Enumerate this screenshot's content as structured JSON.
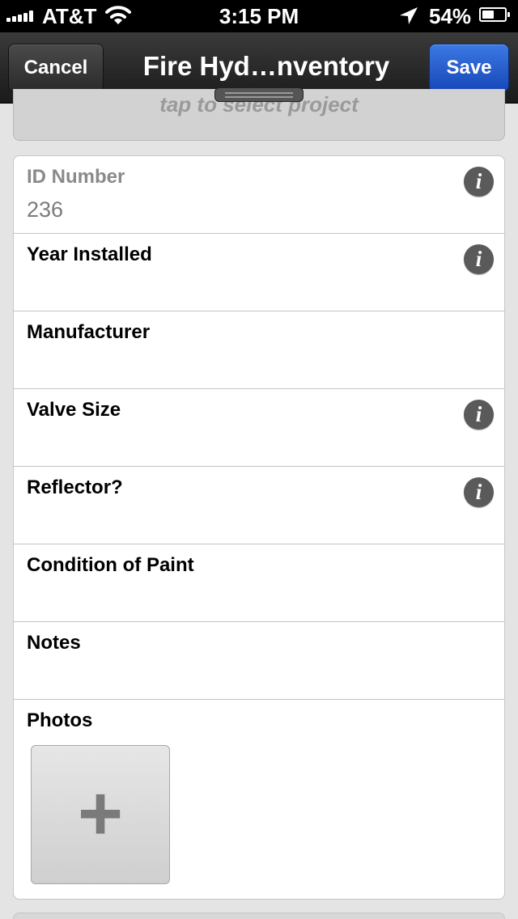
{
  "status_bar": {
    "carrier": "AT&T",
    "time": "3:15 PM",
    "battery_percent": "54%",
    "battery_level": 0.54,
    "icons": [
      "signal-icon",
      "wifi-icon",
      "location-arrow-icon",
      "battery-icon"
    ]
  },
  "nav": {
    "cancel_label": "Cancel",
    "title": "Fire Hyd…nventory",
    "save_label": "Save",
    "save_color": "#1f55c8"
  },
  "project": {
    "hint": "tap to select project"
  },
  "fields": [
    {
      "label": "ID Number",
      "value": "236",
      "has_info": true
    },
    {
      "label": "Year Installed",
      "value": "",
      "has_info": true
    },
    {
      "label": "Manufacturer",
      "value": "",
      "has_info": false
    },
    {
      "label": "Valve Size",
      "value": "",
      "has_info": true
    },
    {
      "label": "Reflector?",
      "value": "",
      "has_info": true
    },
    {
      "label": "Condition of Paint",
      "value": "",
      "has_info": false
    },
    {
      "label": "Notes",
      "value": "",
      "has_info": false
    }
  ],
  "photos": {
    "label": "Photos",
    "add_icon": "plus-icon",
    "add_glyph": "+"
  },
  "info_glyph": "i"
}
